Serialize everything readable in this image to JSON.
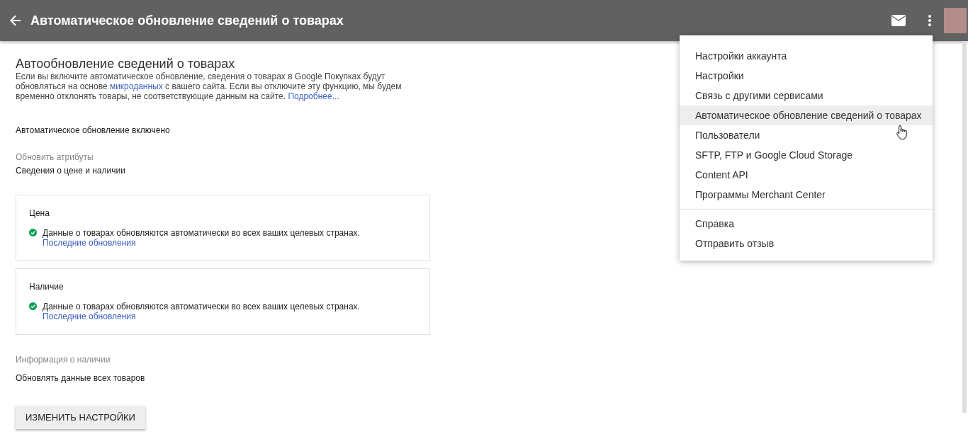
{
  "header": {
    "title": "Автоматическое обновление сведений о товарах"
  },
  "section": {
    "heading": "Автообновление сведений о товарах",
    "description": [
      {
        "kind": "text",
        "text": "Если вы включите автоматическое обновление, сведения о товарах в Google Покупках будут обновляться на основе "
      },
      {
        "kind": "link",
        "text": "микроданных"
      },
      {
        "kind": "text",
        "text": " с вашего сайта. Если вы отключите эту функцию, мы будем временно отклонять товары, не соответствующие данным на сайте. "
      },
      {
        "kind": "link",
        "text": "Подробнее..."
      }
    ],
    "status": "Автоматическое обновление включено",
    "attributes_label": "Обновить атрибуты",
    "attributes_value": "Сведения о цене и наличии"
  },
  "cards": [
    {
      "title": "Цена",
      "updated": true,
      "message": "Данные о товарах обновляются автоматически во всех ваших целевых странах.",
      "link": "Последние обновления"
    },
    {
      "title": "Наличие",
      "updated": true,
      "message": "Данные о товарах обновляются автоматически во всех ваших целевых странах.",
      "link": "Последние обновления"
    }
  ],
  "availability": {
    "label": "Информация о наличии",
    "value": "Обновлять данные всех товаров"
  },
  "button": "ИЗМЕНИТЬ НАСТРОЙКИ",
  "menu": {
    "groups": [
      [
        {
          "label": "Настройки аккаунта",
          "selected": false
        },
        {
          "label": "Настройки",
          "selected": false
        },
        {
          "label": "Связь с другими сервисами",
          "selected": false
        },
        {
          "label": "Автоматическое обновление сведений о товарах",
          "selected": true
        },
        {
          "label": "Пользователи",
          "selected": false
        },
        {
          "label": "SFTP, FTP и Google Cloud Storage",
          "selected": false
        },
        {
          "label": "Content API",
          "selected": false
        },
        {
          "label": "Программы Merchant Center",
          "selected": false
        }
      ],
      [
        {
          "label": "Справка",
          "selected": false
        },
        {
          "label": "Отправить отзыв",
          "selected": false
        }
      ]
    ]
  }
}
